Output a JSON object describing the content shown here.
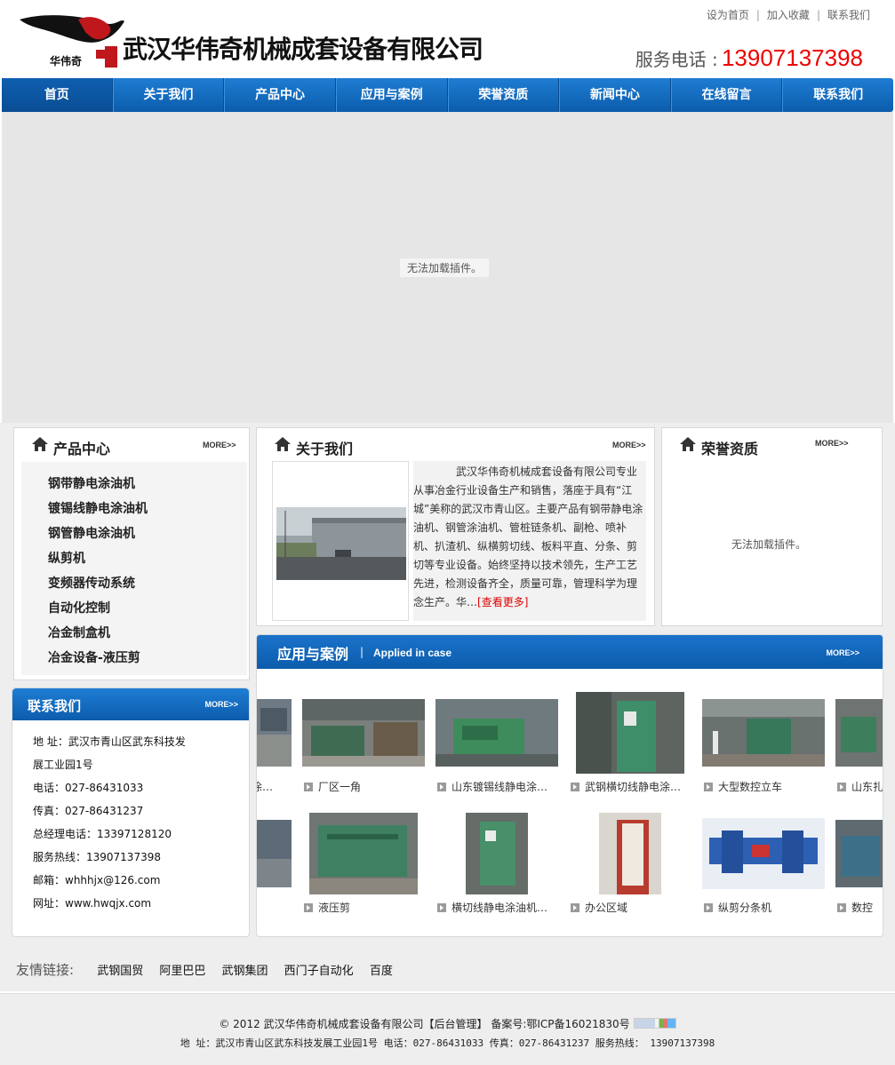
{
  "header": {
    "logo_text": "武汉华伟奇机械成套设备有限公司",
    "logo_sub": "华伟奇",
    "top_links": [
      "设为首页",
      "加入收藏",
      "联系我们"
    ],
    "hotline_label": "服务电话 :",
    "hotline_number": "13907137398"
  },
  "nav": {
    "items": [
      "首页",
      "关于我们",
      "产品中心",
      "应用与案例",
      "荣誉资质",
      "新闻中心",
      "在线留言",
      "联系我们"
    ],
    "active_index": 0
  },
  "banner": {
    "message": "无法加载插件。"
  },
  "products": {
    "title": "产品中心",
    "more": "MORE>>",
    "items": [
      "钢带静电涂油机",
      "镀锡线静电涂油机",
      "钢管静电涂油机",
      "纵剪机",
      "变频器传动系统",
      "自动化控制",
      "冶金制盒机",
      "冶金设备-液压剪"
    ]
  },
  "about": {
    "title": "关于我们",
    "more": "MORE>>",
    "text": "武汉华伟奇机械成套设备有限公司专业从事冶金行业设备生产和销售，落座于具有“江城”美称的武汉市青山区。主要产品有钢带静电涂油机、钢管涂油机、管桩链条机、副枪、喷补机、扒渣机、纵横剪切线、板料平直、分条、剪切等专业设备。始终坚持以技术领先，生产工艺先进，检测设备齐全，质量可靠，管理科学为理念生产。华…",
    "read_more": "[查看更多]"
  },
  "honors": {
    "title": "荣誉资质",
    "more": "MORE>>",
    "message": "无法加载插件。"
  },
  "contact": {
    "title": "联系我们",
    "more": "MORE>>",
    "lines": [
      "地 址：武汉市青山区武东科技发",
      "展工业园1号",
      "电话：027-86431033",
      "传真：027-86431237",
      "总经理电话：13397128120",
      "服务热线：13907137398",
      "邮箱：whhhjx@126.com",
      "网址：www.hwqjx.com"
    ]
  },
  "cases": {
    "title": "应用与案例",
    "sep": "|",
    "en_title": "Applied in case",
    "more": "MORE>>",
    "row1": [
      "涂…",
      "厂区一角",
      "山东镀锡线静电涂…",
      "武钢横切线静电涂…",
      "大型数控立车",
      "山东扎"
    ],
    "row2": [
      "液压剪",
      "横切线静电涂油机…",
      "办公区域",
      "纵剪分条机",
      "数控"
    ]
  },
  "links": {
    "label": "友情链接:",
    "items": [
      "武钢国贸",
      "阿里巴巴",
      "武钢集团",
      "西门子自动化",
      "百度"
    ]
  },
  "footer": {
    "line1": "© 2012  武汉华伟奇机械成套设备有限公司【后台管理】 备案号:鄂ICP备16021830号",
    "line2": "地 址：武汉市青山区武东科技发展工业园1号 电话：027-86431033 传真：027-86431237 服务热线： 13907137398"
  },
  "colors": {
    "nav_blue": "#0c5cad",
    "accent_red": "#ee0000"
  }
}
